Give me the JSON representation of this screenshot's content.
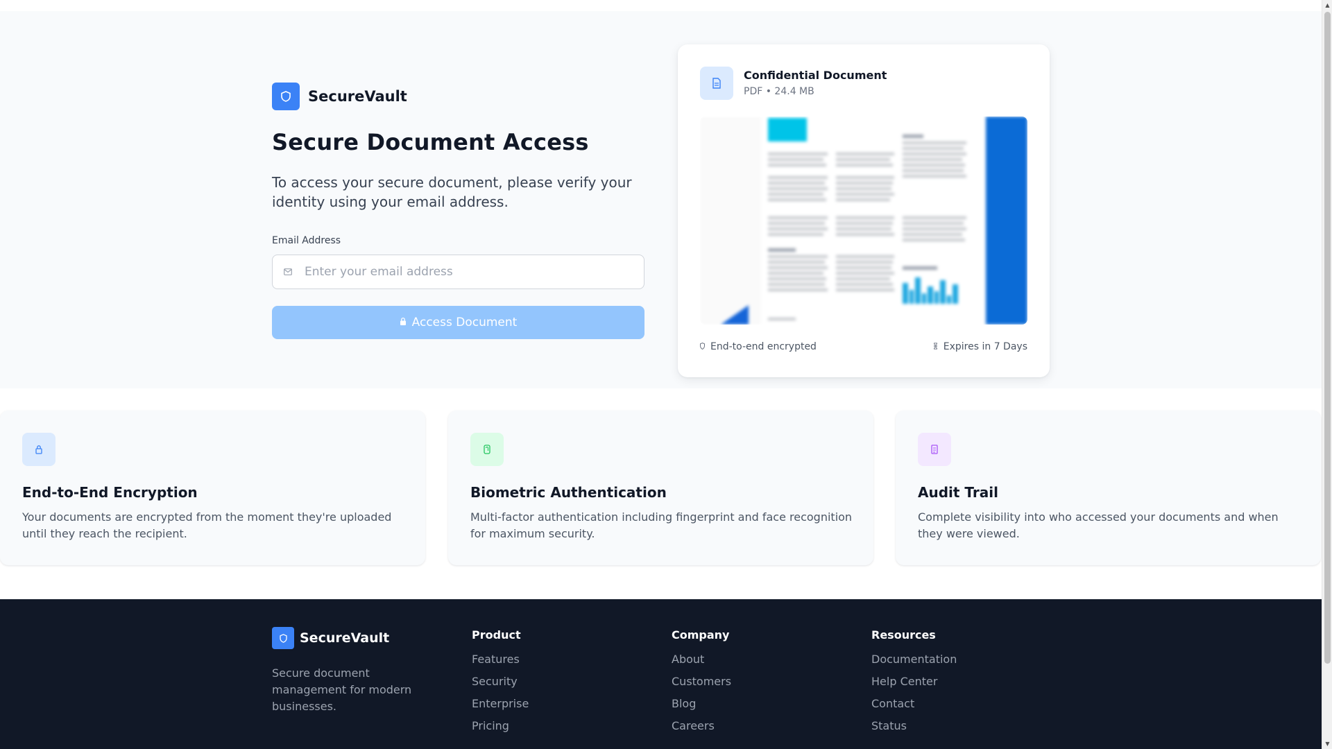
{
  "brand": {
    "name": "SecureVault"
  },
  "hero": {
    "title": "Secure Document Access",
    "subtitle": "To access your secure document, please verify your identity using your email address.",
    "email_label": "Email Address",
    "email_placeholder": "Enter your email address",
    "email_value": "",
    "access_button": "Access Document"
  },
  "document": {
    "title": "Confidential Document",
    "meta": "PDF • 24.4 MB",
    "encryption": "End-to-end encrypted",
    "expiry": "Expires in 7 Days",
    "icon": "file-icon"
  },
  "features": [
    {
      "title": "End-to-End Encryption",
      "description": "Your documents are encrypted from the moment they're uploaded until they reach the recipient.",
      "icon": "lock-icon",
      "icon_color": "#3b82f6",
      "icon_bg": "#dbeafe"
    },
    {
      "title": "Biometric Authentication",
      "description": "Multi-factor authentication including fingerprint and face recognition for maximum security.",
      "icon": "fingerprint-icon",
      "icon_color": "#22c55e",
      "icon_bg": "#dcfce7"
    },
    {
      "title": "Audit Trail",
      "description": "Complete visibility into who accessed your documents and when they were viewed.",
      "icon": "history-icon",
      "icon_color": "#a855f7",
      "icon_bg": "#f3e8ff"
    }
  ],
  "footer": {
    "brand": "SecureVault",
    "tagline": "Secure document management for modern businesses.",
    "columns": [
      {
        "title": "Product",
        "links": [
          "Features",
          "Security",
          "Enterprise",
          "Pricing"
        ]
      },
      {
        "title": "Company",
        "links": [
          "About",
          "Customers",
          "Blog",
          "Careers"
        ]
      },
      {
        "title": "Resources",
        "links": [
          "Documentation",
          "Help Center",
          "Contact",
          "Status"
        ]
      }
    ]
  },
  "colors": {
    "accent": "#3b82f6",
    "button_disabled": "#93c5fd",
    "footer_bg": "#111827",
    "hero_bg": "#f8fafc"
  }
}
